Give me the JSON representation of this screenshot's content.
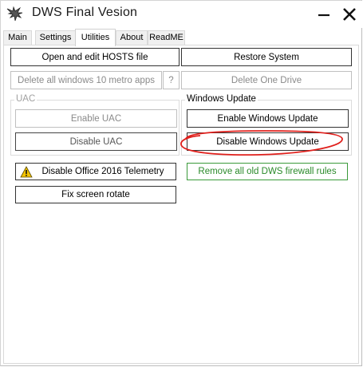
{
  "window": {
    "title": "DWS Final Vesion",
    "minimize_icon": "minimize-icon",
    "close_icon": "close-icon",
    "app_icon": "app-icon"
  },
  "tabs": [
    {
      "label": "Main",
      "active": false
    },
    {
      "label": "Settings",
      "active": false
    },
    {
      "label": "Utilities",
      "active": true
    },
    {
      "label": "About",
      "active": false
    },
    {
      "label": "ReadME",
      "active": false
    }
  ],
  "utilities": {
    "open_hosts": "Open and edit HOSTS file",
    "restore_system": "Restore System",
    "delete_metro_apps": "Delete all windows 10 metro apps",
    "help": "?",
    "delete_onedrive": "Delete One Drive",
    "uac_group": {
      "label": "UAC",
      "enable": "Enable UAC",
      "disable": "Disable UAC"
    },
    "windows_update_group": {
      "label": "Windows Update",
      "enable": "Enable Windows Update",
      "disable": "Disable Windows Update"
    },
    "disable_office_telemetry": "Disable Office 2016 Telemetry",
    "remove_firewall_rules": "Remove all old DWS firewall rules",
    "fix_screen_rotate": "Fix screen rotate"
  },
  "colors": {
    "annotation_circle": "#e0201c",
    "green_button": "#2a8a2a",
    "disabled_text": "#8a8a8a"
  }
}
